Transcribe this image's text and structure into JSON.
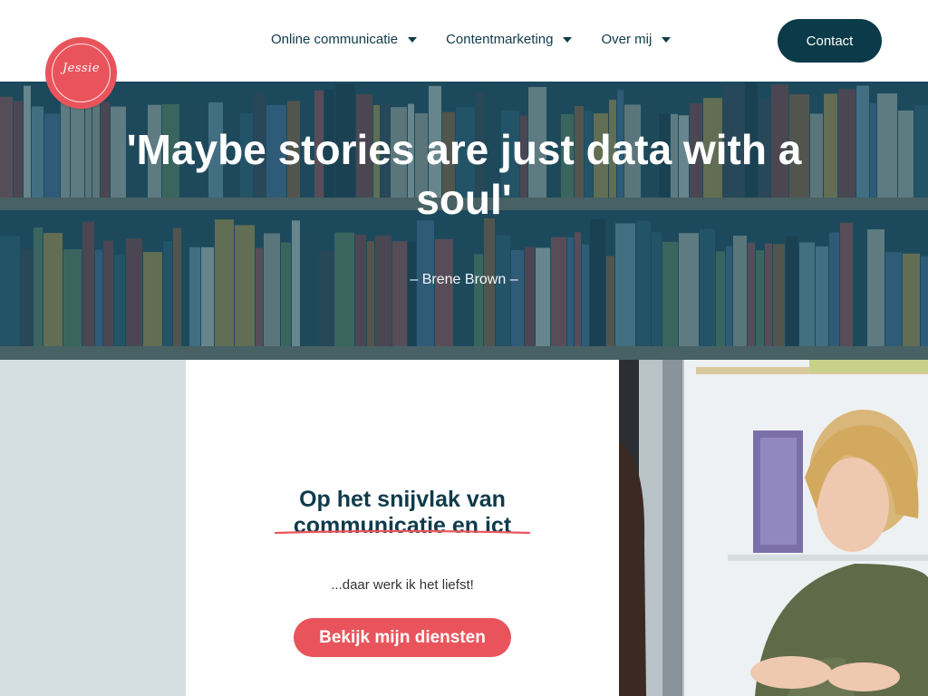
{
  "header": {
    "logo_text": "Jessie",
    "nav": [
      {
        "label": "Online communicatie"
      },
      {
        "label": "Contentmarketing"
      },
      {
        "label": "Over mij"
      }
    ],
    "contact_label": "Contact"
  },
  "hero": {
    "quote": "'Maybe stories are just data with a soul'",
    "author": "– Brene Brown –"
  },
  "intro": {
    "headline_line1": "Op het snijvlak van",
    "headline_line2": "communicatie en ict",
    "subtitle": "...daar werk ik het liefst!",
    "cta_label": "Bekijk mijn diensten"
  },
  "colors": {
    "brand_red": "#e9545c",
    "brand_dark": "#0b3a48",
    "side_band": "#d5dee2"
  }
}
